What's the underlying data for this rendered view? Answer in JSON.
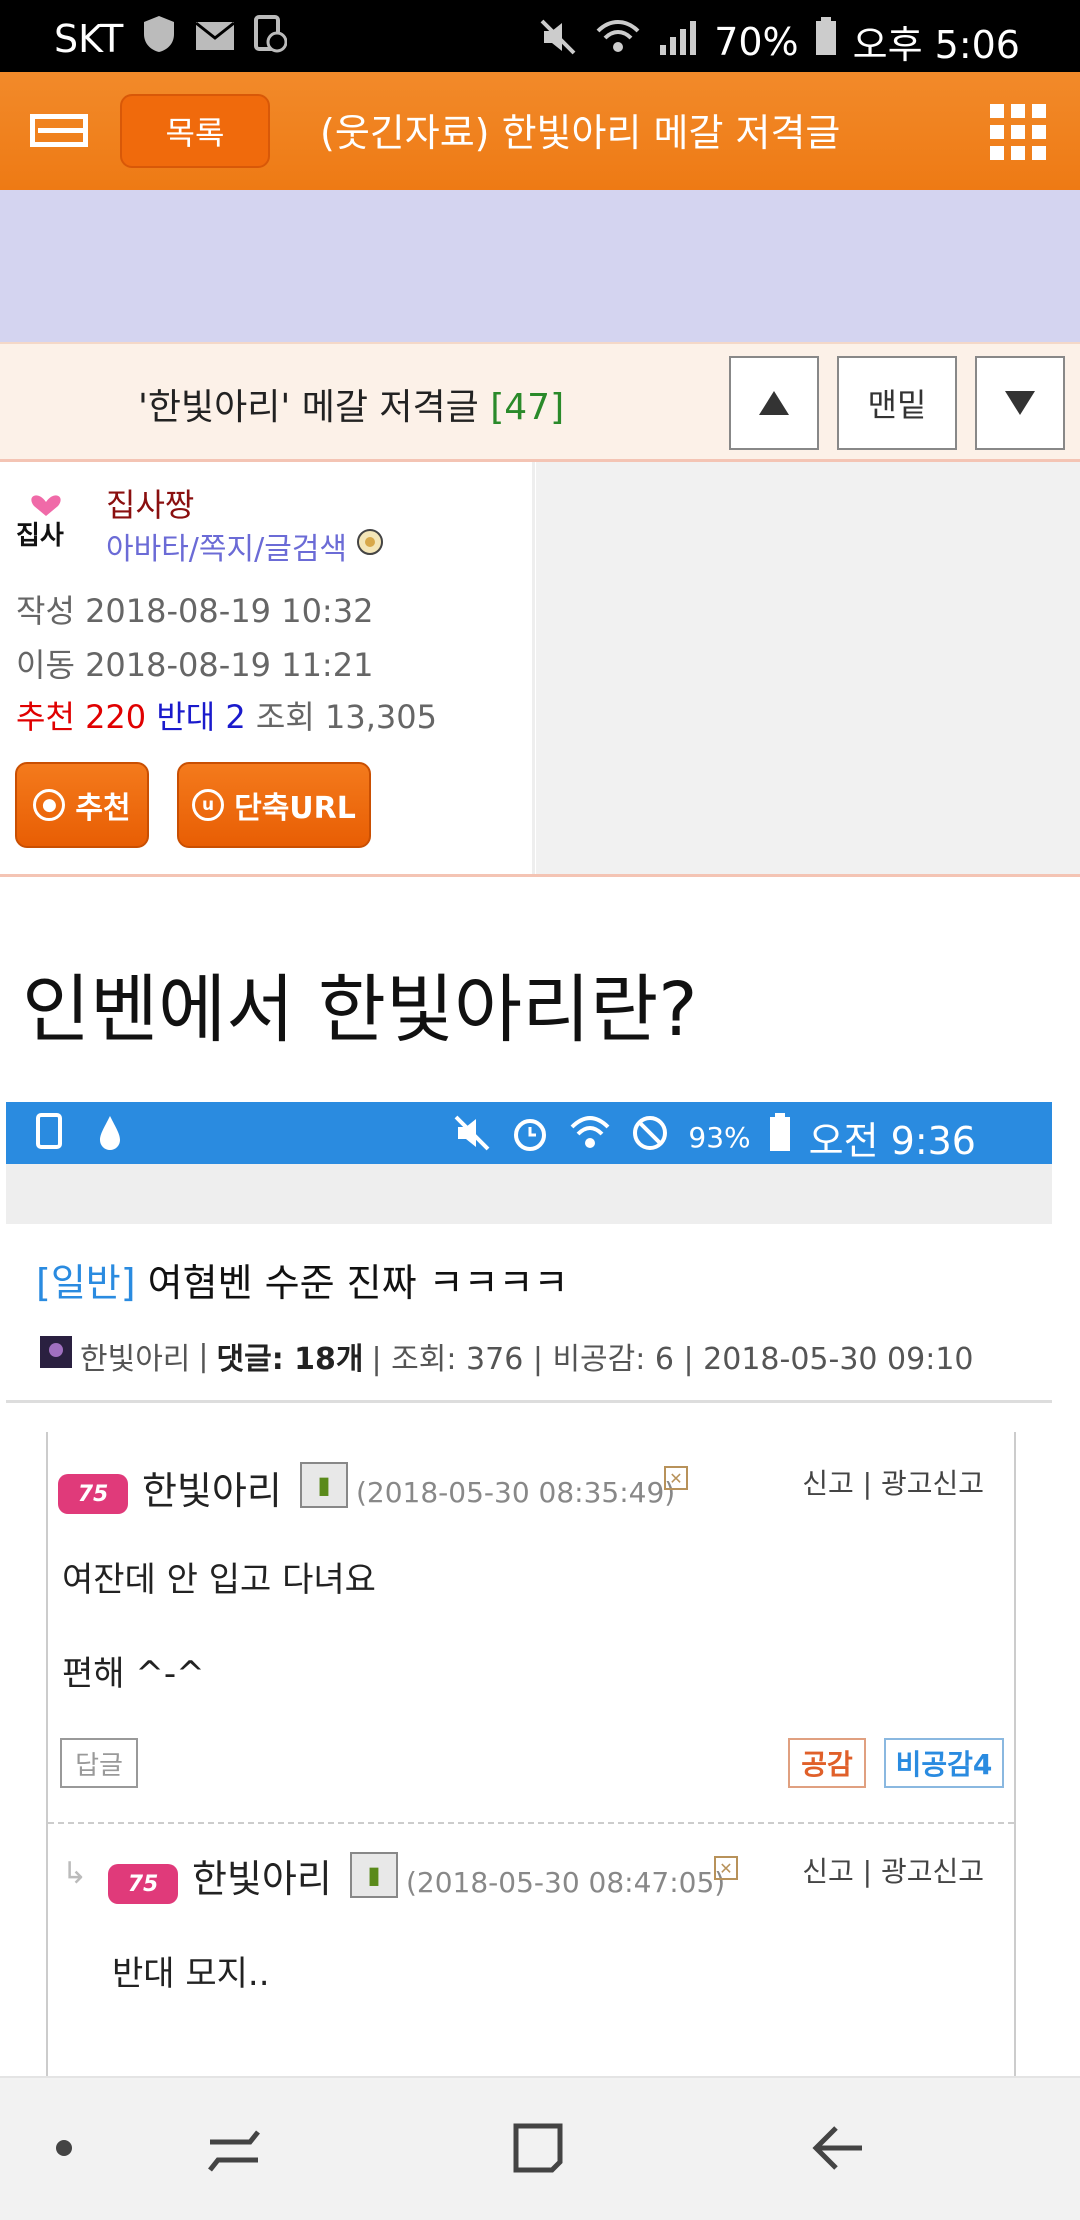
{
  "status_bar": {
    "carrier": "SKT",
    "battery": "70%",
    "time": "오후 5:06"
  },
  "app_bar": {
    "list_label": "목록",
    "title": "(웃긴자료) 한빛아리 메갈 저격글"
  },
  "post": {
    "title": "'한빛아리' 메갈 저격글",
    "comment_count": "[47]",
    "bottom_label": "맨밑"
  },
  "author": {
    "name": "집사짱",
    "links": "아바타/쪽지/글검색",
    "written_label": "작성",
    "written": "2018-08-19 10:32",
    "moved_label": "이동",
    "moved": "2018-08-19 11:21",
    "up_label": "추천",
    "up": "220",
    "down_label": "반대",
    "down": "2",
    "views_label": "조회",
    "views": "13,305",
    "recommend_button": "추천",
    "short_url_button": "단축URL"
  },
  "content": {
    "headline": "인벤에서 한빛아리란?",
    "embed": {
      "status_battery": "93%",
      "status_time": "오전 9:36",
      "category": "[일반]",
      "title": "여혐벤 수준 진짜 ㅋㅋㅋㅋ",
      "meta_author": "한빛아리",
      "meta_comments_label": "댓글:",
      "meta_comments": "18",
      "meta_comments_unit": "개",
      "meta_rest": "| 조회: 376 | 비공감: 6 | 2018-05-30 09:10",
      "comments": [
        {
          "level": "75",
          "name": "한빛아리",
          "date": "(2018-05-30 08:35:49)",
          "report": "신고 | 광고신고",
          "line1": "여잔데 안 입고 다녀요",
          "line2": "편해 ^-^",
          "reply": "답글",
          "agree": "공감",
          "disagree": "비공감4"
        },
        {
          "level": "75",
          "name": "한빛아리",
          "date": "(2018-05-30 08:47:05)",
          "report": "신고 | 광고신고",
          "line1": "반대 모지.."
        }
      ]
    }
  },
  "colors": {
    "brand_orange": "#ee7a14",
    "upvote_red": "#e00000",
    "downvote_blue": "#1a1acc",
    "embed_blue": "#2a8be0"
  }
}
